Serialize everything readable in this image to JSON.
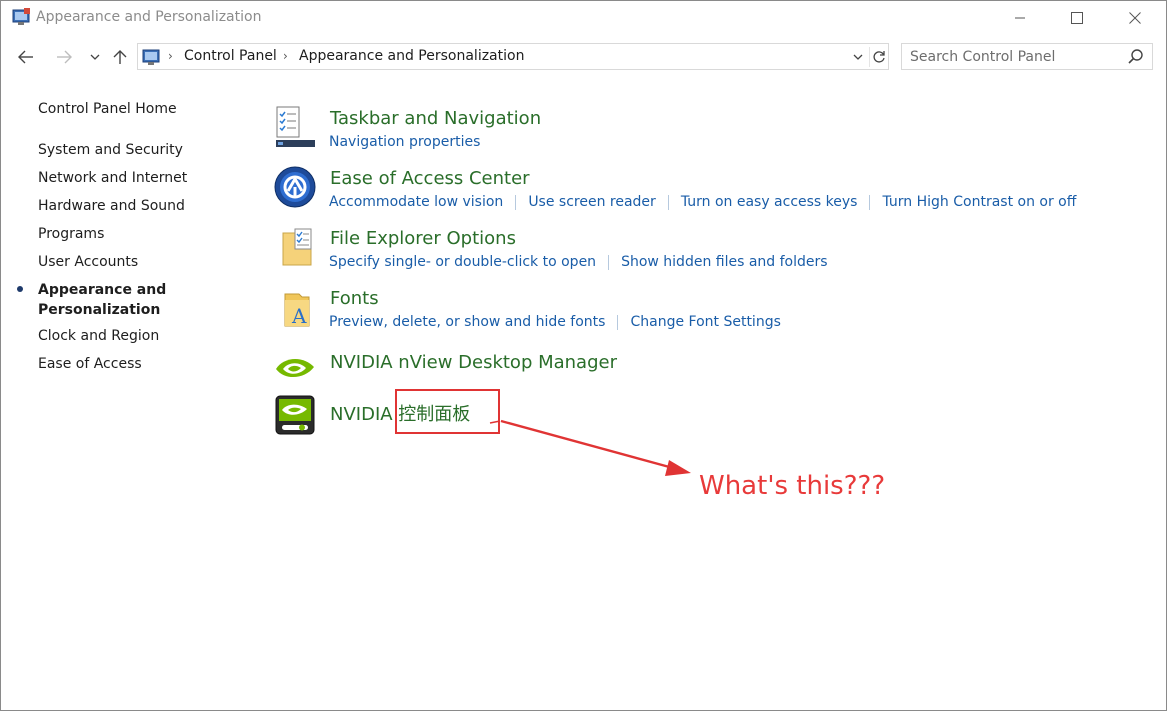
{
  "window": {
    "title": "Appearance and Personalization"
  },
  "address": {
    "crumbs": [
      "Control Panel",
      "Appearance and Personalization"
    ]
  },
  "search": {
    "placeholder": "Search Control Panel"
  },
  "sidebar": {
    "items": [
      {
        "label": "Control Panel Home"
      },
      {
        "label": "System and Security"
      },
      {
        "label": "Network and Internet"
      },
      {
        "label": "Hardware and Sound"
      },
      {
        "label": "Programs"
      },
      {
        "label": "User Accounts"
      },
      {
        "label": "Appearance and Personalization",
        "line1": "Appearance and",
        "line2": "Personalization",
        "active": true
      },
      {
        "label": "Clock and Region"
      },
      {
        "label": "Ease of Access"
      }
    ]
  },
  "categories": [
    {
      "title": "Taskbar and Navigation",
      "icon": "taskbar-icon",
      "links": [
        "Navigation properties"
      ]
    },
    {
      "title": "Ease of Access Center",
      "icon": "ease-of-access-icon",
      "links": [
        "Accommodate low vision",
        "Use screen reader",
        "Turn on easy access keys",
        "Turn High Contrast on or off"
      ]
    },
    {
      "title": "File Explorer Options",
      "icon": "file-explorer-options-icon",
      "links": [
        "Specify single- or double-click to open",
        "Show hidden files and folders"
      ]
    },
    {
      "title": "Fonts",
      "icon": "fonts-icon",
      "links": [
        "Preview, delete, or show and hide fonts",
        "Change Font Settings"
      ]
    },
    {
      "title": "NVIDIA nView Desktop Manager",
      "icon": "nvidia-nview-icon",
      "links": []
    },
    {
      "title": "NVIDIA 控制面板",
      "icon": "nvidia-control-panel-icon",
      "links": []
    }
  ],
  "annotation": {
    "text": "What's this???"
  },
  "colors": {
    "category_title": "#2a6e2a",
    "link": "#1a5da8",
    "annotation": "#e83a3a"
  }
}
